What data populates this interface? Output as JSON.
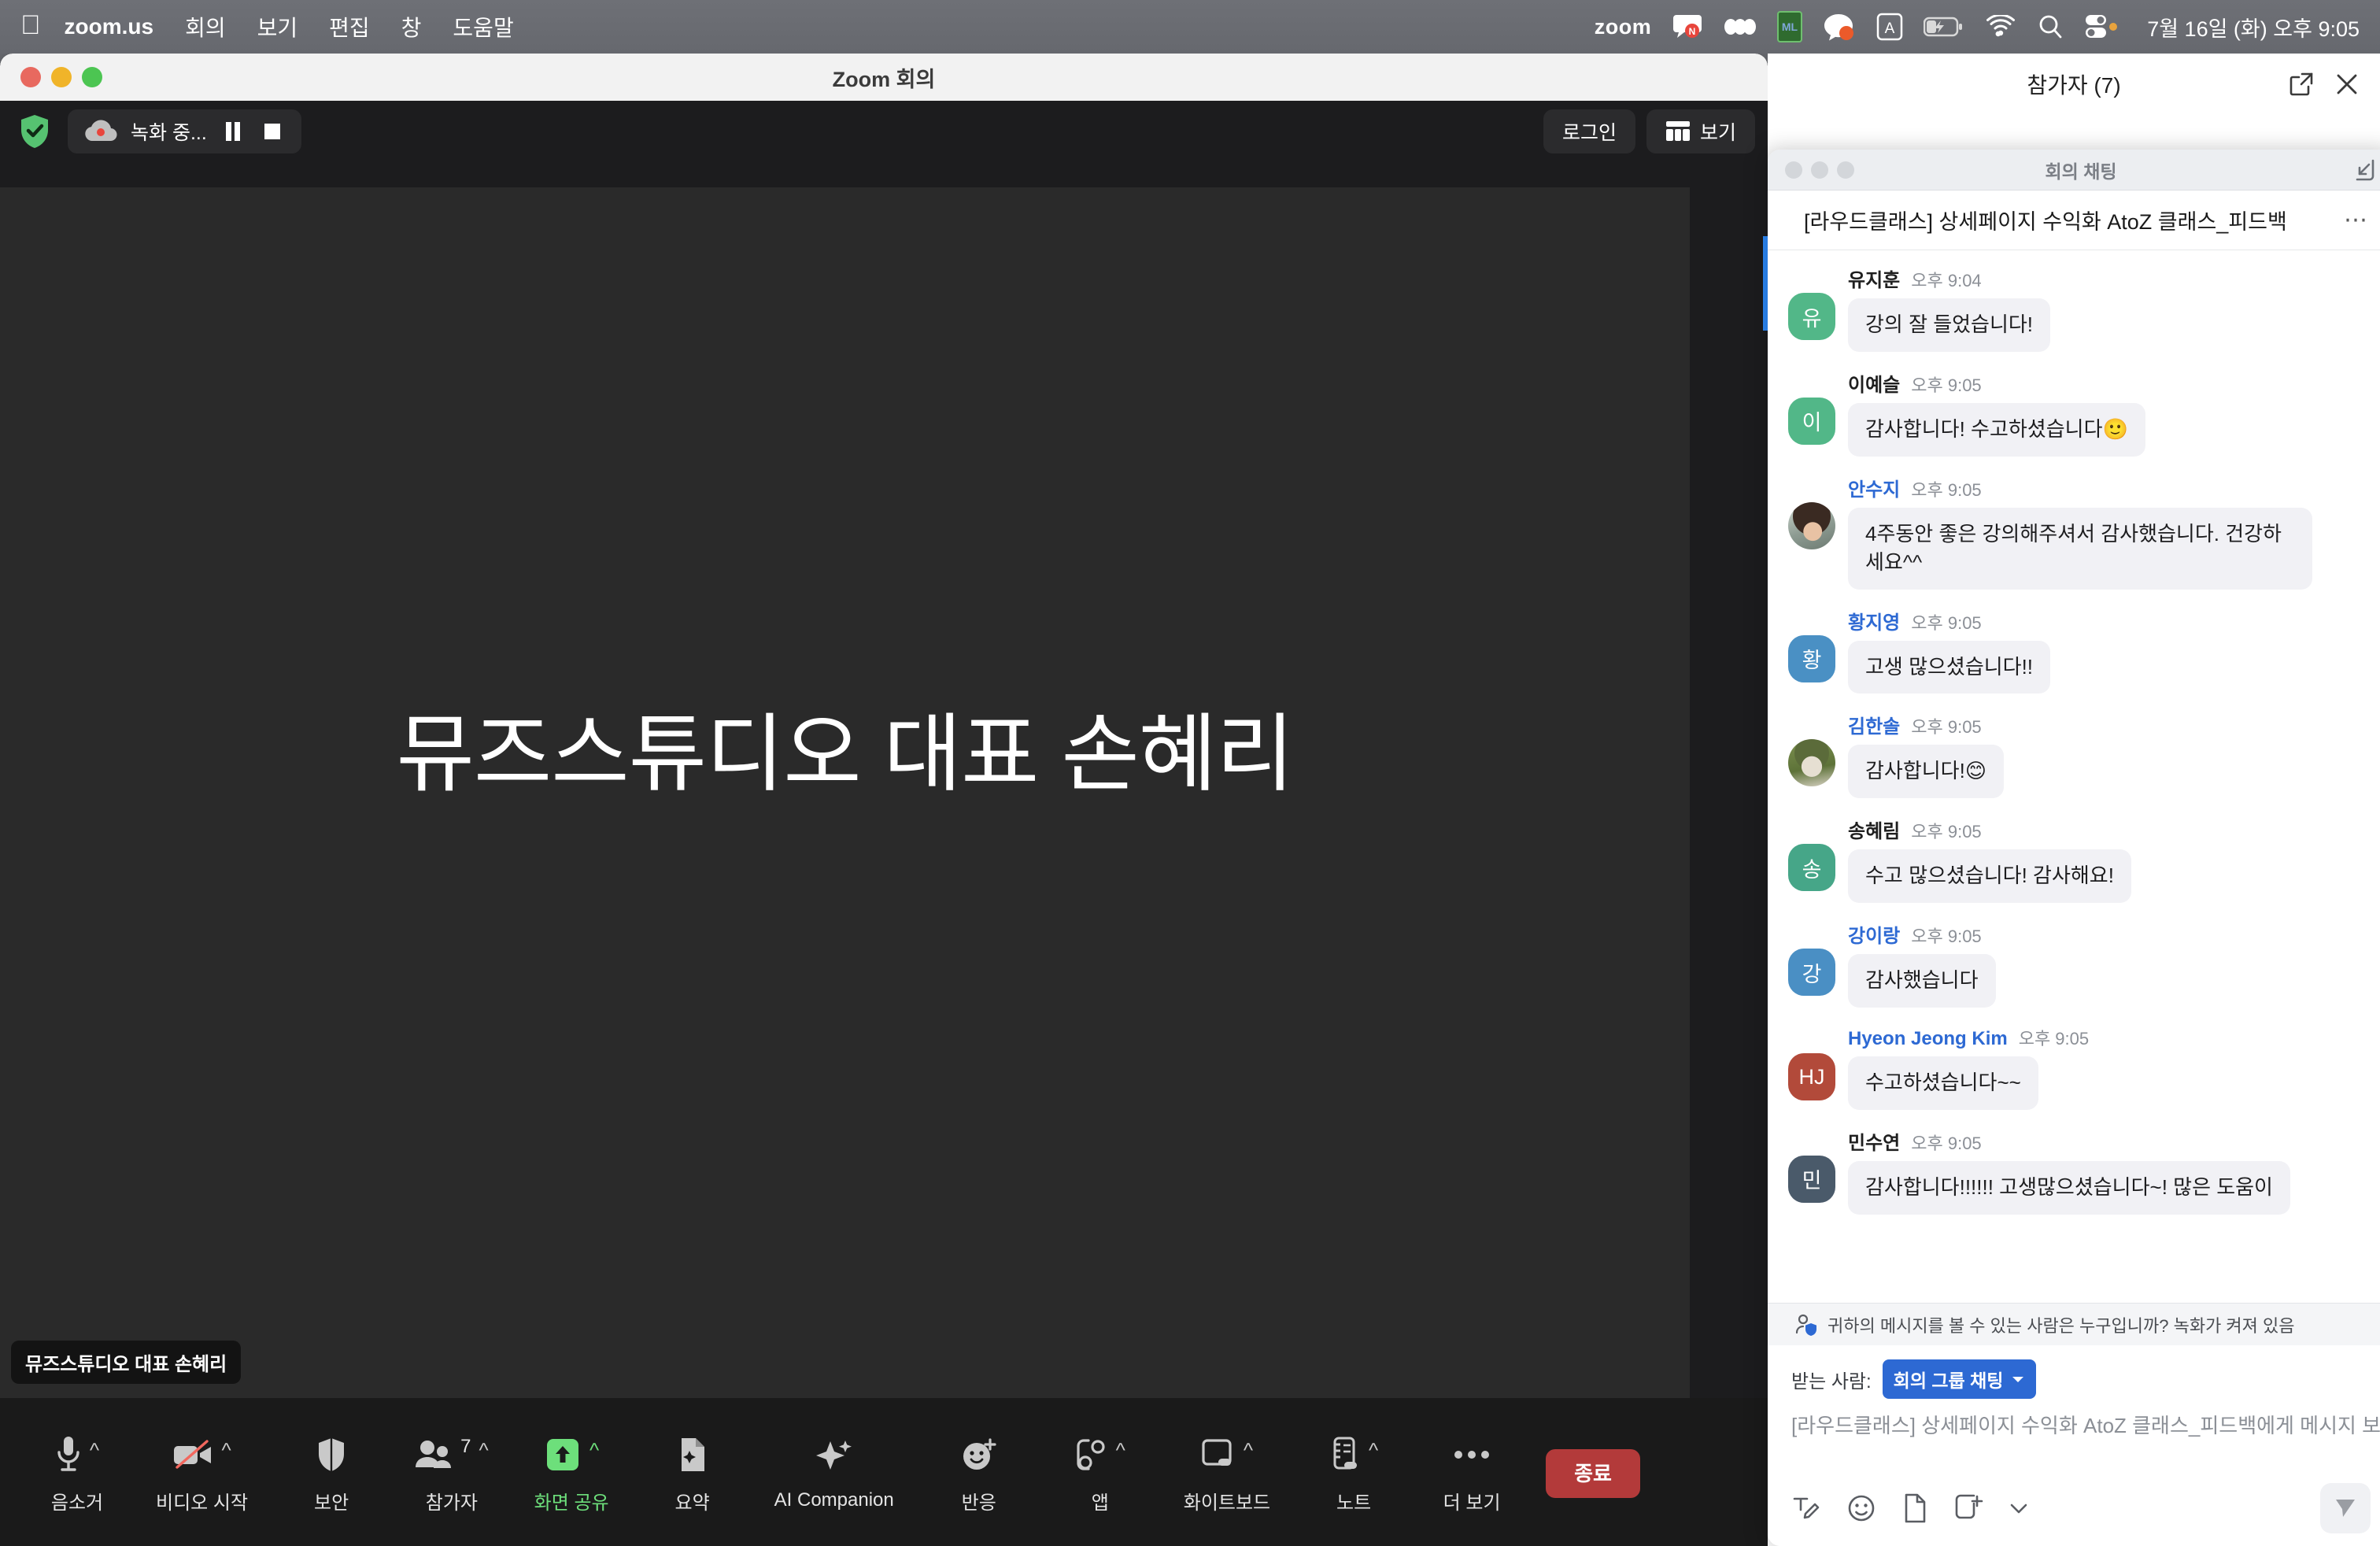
{
  "menubar": {
    "apple_icon": "apple-logo-icon",
    "app_name": "zoom.us",
    "items": [
      "회의",
      "보기",
      "편집",
      "창",
      "도움말"
    ],
    "tray": {
      "zoom_word": "zoom",
      "icons": [
        "chat-bubble-n-icon",
        "beans-icon",
        "ml-badge-icon",
        "kakao-icon",
        "input-source-a-icon",
        "battery-charging-icon",
        "wifi-icon",
        "search-icon",
        "control-center-icon"
      ],
      "ml_badge_label": "ML",
      "input_source_label": "A",
      "clock": "7월 16일 (화) 오후 9:05"
    }
  },
  "window": {
    "title": "Zoom 회의"
  },
  "topstrip": {
    "shield_icon": "security-shield-check-icon",
    "recording_label": "녹화 중...",
    "recording_cloud_icon": "cloud-recording-icon",
    "pause_icon": "pause-icon",
    "stop_icon": "stop-icon",
    "login_label": "로그인",
    "view_label": "보기",
    "view_icon": "layout-grid-icon"
  },
  "stage": {
    "title": "뮤즈스튜디오 대표 손혜리",
    "name_badge": "뮤즈스튜디오 대표 손혜리"
  },
  "toolbar": {
    "items": [
      {
        "label": "음소거",
        "icon": "microphone-icon",
        "caret": true,
        "green": false,
        "count": ""
      },
      {
        "label": "비디오 시작",
        "icon": "video-off-icon",
        "caret": true,
        "green": false,
        "count": ""
      },
      {
        "label": "보안",
        "icon": "shield-icon",
        "caret": false,
        "green": false,
        "count": ""
      },
      {
        "label": "참가자",
        "icon": "participants-icon",
        "caret": true,
        "green": false,
        "count": "7"
      },
      {
        "label": "화면 공유",
        "icon": "share-screen-icon",
        "caret": true,
        "green": true,
        "count": ""
      },
      {
        "label": "요약",
        "icon": "summary-doc-icon",
        "caret": false,
        "green": false,
        "count": ""
      },
      {
        "label": "AI Companion",
        "icon": "ai-sparkle-icon",
        "caret": false,
        "green": false,
        "count": ""
      },
      {
        "label": "반응",
        "icon": "reactions-icon",
        "caret": false,
        "green": false,
        "count": ""
      },
      {
        "label": "앱",
        "icon": "apps-icon",
        "caret": true,
        "green": false,
        "count": ""
      },
      {
        "label": "화이트보드",
        "icon": "whiteboard-icon",
        "caret": true,
        "green": false,
        "count": ""
      },
      {
        "label": "노트",
        "icon": "notes-icon",
        "caret": true,
        "green": false,
        "count": ""
      },
      {
        "label": "더 보기",
        "icon": "more-ellipsis-icon",
        "caret": false,
        "green": false,
        "count": ""
      }
    ],
    "end_label": "종료"
  },
  "participants_panel": {
    "title": "참가자 (7)",
    "popout_icon": "popout-icon",
    "close_icon": "close-icon"
  },
  "chat": {
    "window_title": "회의 채팅",
    "popin_icon": "popin-icon",
    "thread_title": "[라우드클래스] 상세페이지 수익화 AtoZ 클래스_피드백",
    "more_icon": "more-ellipsis-icon",
    "messages": [
      {
        "sender": "유지훈",
        "sender_color": "dark",
        "time": "오후 9:04",
        "text": "강의 잘 들었습니다!",
        "avatar_type": "initial",
        "avatar_text": "유",
        "avatar_color": "#52B788"
      },
      {
        "sender": "이예슬",
        "sender_color": "dark",
        "time": "오후 9:05",
        "text": "감사합니다! 수고하셨습니다🙂",
        "avatar_type": "initial",
        "avatar_text": "이",
        "avatar_color": "#52B788"
      },
      {
        "sender": "안수지",
        "sender_color": "blue",
        "time": "오후 9:05",
        "text": "4주동안 좋은 강의해주셔서 감사했습니다. 건강하세요^^",
        "avatar_type": "photo",
        "avatar_text": "",
        "avatar_color": "#8d9b92"
      },
      {
        "sender": "황지영",
        "sender_color": "blue",
        "time": "오후 9:05",
        "text": "고생 많으셨습니다!!",
        "avatar_type": "initial",
        "avatar_text": "황",
        "avatar_color": "#4A90C4"
      },
      {
        "sender": "김한솔",
        "sender_color": "blue",
        "time": "오후 9:05",
        "text": "감사합니다!😊",
        "avatar_type": "photo",
        "avatar_text": "",
        "avatar_color": "#7d9150"
      },
      {
        "sender": "송혜림",
        "sender_color": "dark",
        "time": "오후 9:05",
        "text": "수고 많으셨습니다! 감사해요!",
        "avatar_type": "initial",
        "avatar_text": "송",
        "avatar_color": "#46A688"
      },
      {
        "sender": "강이랑",
        "sender_color": "blue",
        "time": "오후 9:05",
        "text": "감사했습니다",
        "avatar_type": "initial",
        "avatar_text": "강",
        "avatar_color": "#4A8FC4"
      },
      {
        "sender": "Hyeon Jeong Kim",
        "sender_color": "blue",
        "time": "오후 9:05",
        "text": "수고하셨습니다~~",
        "avatar_type": "initial",
        "avatar_text": "HJ",
        "avatar_color": "#B24A3A"
      },
      {
        "sender": "민수연",
        "sender_color": "dark",
        "time": "오후 9:05",
        "text": "감사합니다!!!!!! 고생많으셨습니다~! 많은 도움이",
        "avatar_type": "initial",
        "avatar_text": "민",
        "avatar_color": "#4A5A6A"
      }
    ],
    "privacy_notice": "귀하의 메시지를 볼 수 있는 사람은 누구입니까? 녹화가 켜져 있음",
    "privacy_icon": "person-shield-icon",
    "composer": {
      "to_label": "받는 사람:",
      "to_value": "회의 그룹 채팅",
      "to_caret_icon": "chevron-down-icon",
      "placeholder": "[라우드클래스] 상세페이지 수익화 AtoZ 클래스_피드백에게 메시지 보내기",
      "tools": [
        "format-text-icon",
        "emoji-icon",
        "file-icon",
        "screenshot-icon",
        "chevron-down-icon"
      ],
      "send_icon": "send-icon"
    }
  }
}
